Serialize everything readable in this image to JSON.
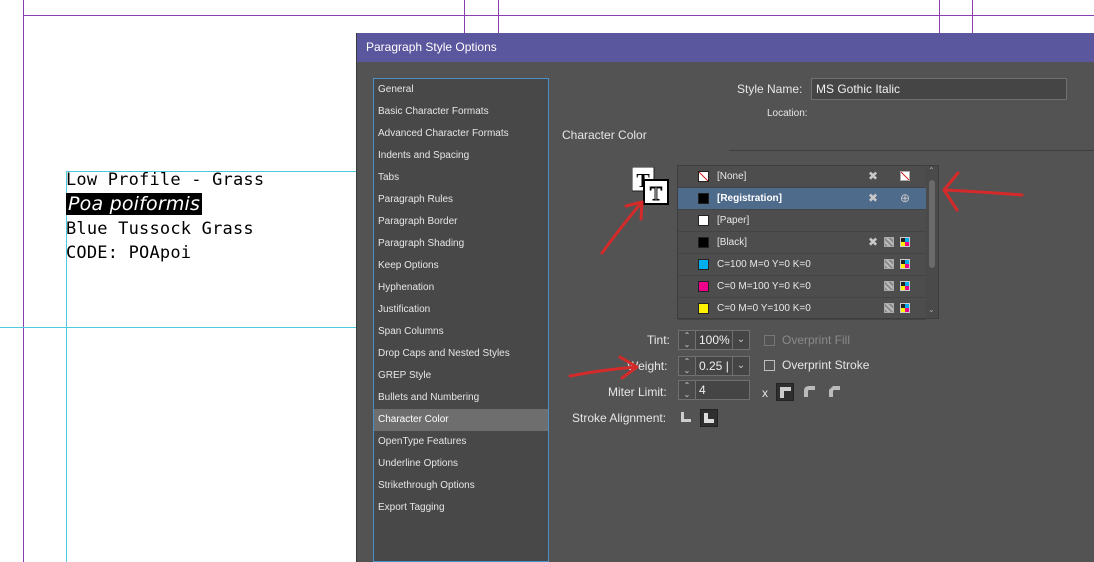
{
  "document": {
    "lines": [
      "Low Profile - Grass",
      "Poa poiformis",
      "Blue Tussock Grass",
      "CODE: POApoi"
    ]
  },
  "dialog": {
    "title": "Paragraph Style Options",
    "sidebar_items": [
      "General",
      "Basic Character Formats",
      "Advanced Character Formats",
      "Indents and Spacing",
      "Tabs",
      "Paragraph Rules",
      "Paragraph Border",
      "Paragraph Shading",
      "Keep Options",
      "Hyphenation",
      "Justification",
      "Span Columns",
      "Drop Caps and Nested Styles",
      "GREP Style",
      "Bullets and Numbering",
      "Character Color",
      "OpenType Features",
      "Underline Options",
      "Strikethrough Options",
      "Export Tagging"
    ],
    "selected_item": "Character Color",
    "style_name_label": "Style Name:",
    "style_name_value": "MS Gothic Italic",
    "location_label": "Location:",
    "section_title": "Character Color",
    "swatches": [
      {
        "name": "[None]",
        "color": "none",
        "selected": false
      },
      {
        "name": "[Registration]",
        "color": "#000000",
        "selected": true
      },
      {
        "name": "[Paper]",
        "color": "#ffffff",
        "selected": false
      },
      {
        "name": "[Black]",
        "color": "#000000",
        "selected": false
      },
      {
        "name": "C=100 M=0 Y=0 K=0",
        "color": "#00aeef",
        "selected": false
      },
      {
        "name": "C=0 M=100 Y=0 K=0",
        "color": "#ec008c",
        "selected": false
      },
      {
        "name": "C=0 M=0 Y=100 K=0",
        "color": "#fff200",
        "selected": false
      }
    ],
    "tint_label": "Tint:",
    "tint_value": "100%",
    "overprint_fill_label": "Overprint Fill",
    "weight_label": "Weight:",
    "weight_value": "0.25 |",
    "overprint_stroke_label": "Overprint Stroke",
    "miter_label": "Miter Limit:",
    "miter_value": "4",
    "miter_x": "x",
    "stroke_alignment_label": "Stroke Alignment:"
  },
  "colors": {
    "titlebar": "#5b579e",
    "dialog_bg": "#535353",
    "selection_row": "#4f6b8c",
    "annotation_arrow": "#d42a2a"
  }
}
